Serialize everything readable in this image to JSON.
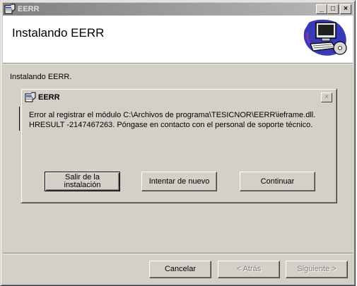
{
  "window": {
    "title": "EERR",
    "controls": {
      "minimize": "_",
      "maximize": "□",
      "close": "×"
    }
  },
  "header": {
    "title": "Instalando EERR",
    "art_icon": "computer-with-cd-icon"
  },
  "status_text": "Instalando EERR.",
  "dialog": {
    "title": "EERR",
    "close": "×",
    "message_line1": "Error al registrar el módulo C:\\Archivos de programa\\TESICNOR\\EERR\\ieframe.dll.",
    "message_line2": "HRESULT -2147467263.  Póngase en contacto con el personal de soporte técnico.",
    "buttons": {
      "exit_line1": "Salir de la",
      "exit_line2": "instalación",
      "retry": "Intentar de nuevo",
      "continue": "Continuar"
    }
  },
  "footer": {
    "cancel": "Cancelar",
    "back": "< Atrás",
    "next": "Siguiente >"
  },
  "colors": {
    "face": "#d4d0c8",
    "inactive_title_start": "#808080",
    "inactive_title_end": "#b8b8b8",
    "art_blue": "#3a3ab8",
    "art_purple": "#7a3ab0"
  }
}
